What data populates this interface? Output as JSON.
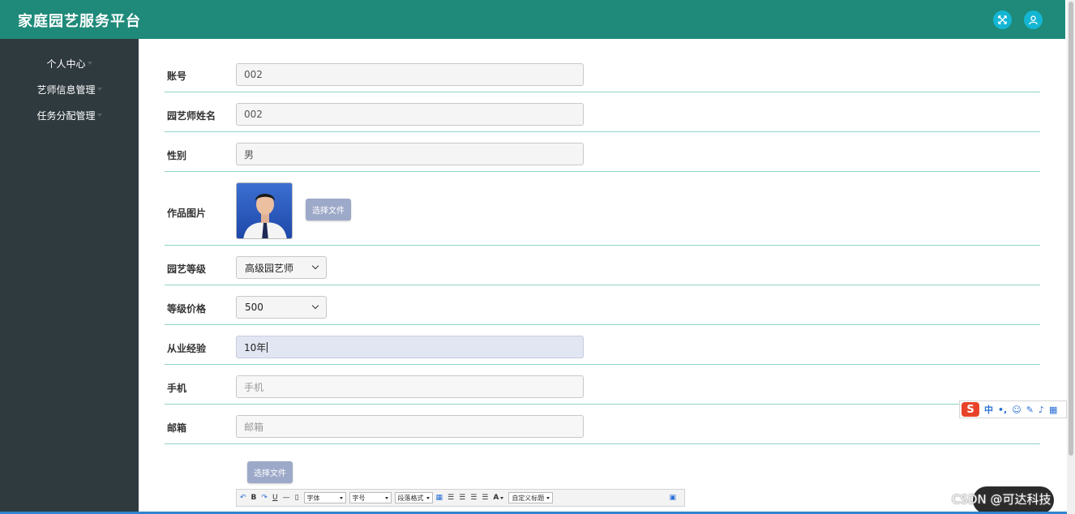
{
  "header": {
    "title": "家庭园艺服务平台",
    "icons": [
      "fullscreen-icon",
      "user-icon"
    ]
  },
  "sidebar": {
    "items": [
      {
        "label": "个人中心"
      },
      {
        "label": "艺师信息管理"
      },
      {
        "label": "任务分配管理"
      }
    ]
  },
  "form": {
    "account": {
      "label": "账号",
      "value": "002"
    },
    "name": {
      "label": "园艺师姓名",
      "value": "002"
    },
    "gender": {
      "label": "性别",
      "value": "男"
    },
    "photo": {
      "label": "作品图片",
      "button": "选择文件"
    },
    "level": {
      "label": "园艺等级",
      "value": "高级园艺师"
    },
    "price": {
      "label": "等级价格",
      "value": "500"
    },
    "experience": {
      "label": "从业经验",
      "value": "10年"
    },
    "phone": {
      "label": "手机",
      "placeholder": "手机"
    },
    "email": {
      "label": "邮箱",
      "placeholder": "邮箱"
    },
    "editor_file_button": "选择文件"
  },
  "editor": {
    "font_label": "字体",
    "size_label": "字号",
    "paragraph_label": "段落格式",
    "custom_label": "自定义标题",
    "bold": "B",
    "underline": "U",
    "font_color": "A"
  },
  "ime": {
    "mode": "中"
  },
  "watermark": "CSDN @可达科技",
  "colors": {
    "header": "#1f8a7a",
    "sidebar": "#2f3a3f",
    "divider": "#8fd3c6",
    "button": "#9da9c8",
    "accent": "#14b6d4"
  }
}
